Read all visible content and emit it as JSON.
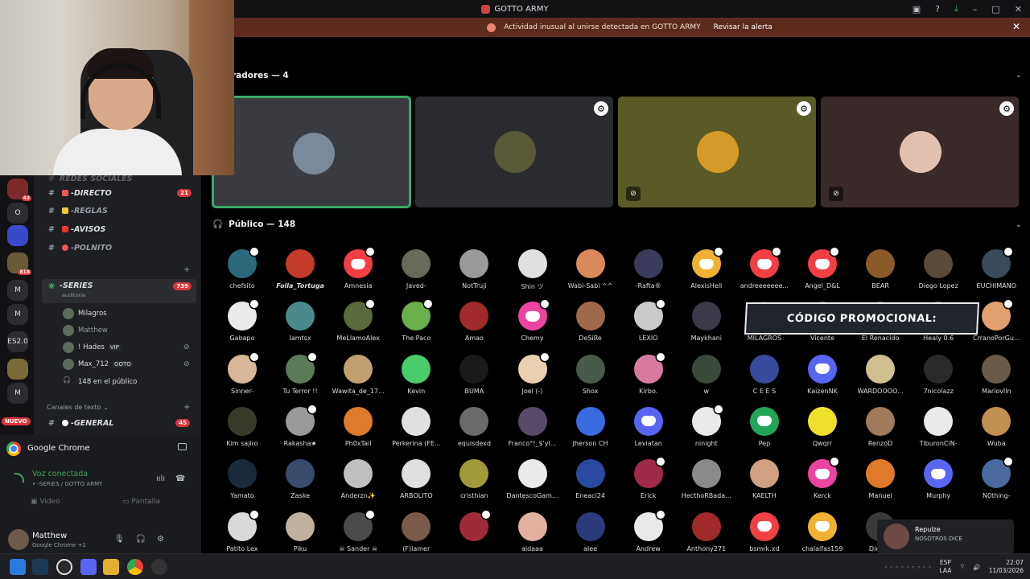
{
  "window": {
    "title": "GOTTO ARMY"
  },
  "alert": {
    "text": "Actividad inusual al unirse detectada en GOTTO ARMY",
    "action": "Revisar la alerta"
  },
  "servers": [
    {
      "label": "",
      "badge": "43",
      "color": "#7a2a2a"
    },
    {
      "label": "O",
      "badge": "",
      "color": "#2b2d31"
    },
    {
      "label": "",
      "badge": "",
      "color": "#3a49c9"
    },
    {
      "label": "",
      "badge": "818",
      "color": "#6a5a3a"
    },
    {
      "label": "M",
      "badge": "",
      "color": "#2b2d31"
    },
    {
      "label": "M",
      "badge": "",
      "color": "#2b2d31"
    },
    {
      "label": "ES2.0",
      "badge": "",
      "color": "#2b2d31"
    },
    {
      "label": "",
      "badge": "",
      "color": "#7a6a3a"
    },
    {
      "label": "M",
      "badge": "",
      "color": "#2b2d31"
    }
  ],
  "nuevo_badge": "NUEVO",
  "channels": {
    "top_faded": "REDES SOCIALES",
    "directo": {
      "name": "DIRECTO",
      "badge": "21"
    },
    "reglas": {
      "name": "REGLAS"
    },
    "avisos": {
      "name": "AVISOS"
    },
    "polnito": {
      "name": "POLNITO"
    },
    "series": {
      "name": "SERIES",
      "badge": "739",
      "sub": "auditoria"
    },
    "text_category": "Canales de texto",
    "general": {
      "name": "GENERAL",
      "badge": "45"
    }
  },
  "voice_users": [
    {
      "name": "Milagros",
      "tag": "",
      "muted": false
    },
    {
      "name": "Matthew",
      "tag": "",
      "muted": false
    },
    {
      "name": "! Hades",
      "tag": "VIP",
      "muted": true
    },
    {
      "name": "Max_712",
      "tag": "GOTO",
      "muted": true
    },
    {
      "name": "148 en el público",
      "tag": "",
      "muted": false
    }
  ],
  "activity": {
    "app": "Google Chrome"
  },
  "voice": {
    "status": "Voz conectada",
    "channel": "• -SERIES / GOTTO ARMY",
    "video": "Video",
    "screen": "Pantalla"
  },
  "user": {
    "name": "Matthew",
    "sub": "Google Chrome +1"
  },
  "stage": {
    "speakers_header": "radores — 4",
    "audience_header": "Público — 148"
  },
  "speaker_tiles": [
    {
      "bg": "#3a3b40",
      "av": "#7a8a9a",
      "gear": false,
      "muted": false,
      "highlight": true
    },
    {
      "bg": "#2a2b2e",
      "av": "#5a5a3a",
      "gear": true,
      "muted": false,
      "highlight": false
    },
    {
      "bg": "#5a5a26",
      "av": "#d59a2a",
      "gear": true,
      "muted": true,
      "highlight": false
    },
    {
      "bg": "#3a2a2a",
      "av": "#e0c0b0",
      "gear": true,
      "muted": true,
      "highlight": false
    }
  ],
  "audience": [
    {
      "name": "chefsito",
      "color": "#2a6a7a",
      "discord": false,
      "hp": true
    },
    {
      "name": "Folla_Tortuga",
      "color": "#c43b2a",
      "discord": false,
      "hp": false
    },
    {
      "name": "Amnesia",
      "color": "#f23f43",
      "discord": true,
      "hp": true
    },
    {
      "name": "Javed-",
      "color": "#6a6a5a",
      "discord": false,
      "hp": false
    },
    {
      "name": "NotTruji",
      "color": "#9a9a9a",
      "discord": false,
      "hp": false
    },
    {
      "name": "Shin ツ",
      "color": "#e0e0e0",
      "discord": false,
      "hp": false
    },
    {
      "name": "Wabi-Sabi ^^",
      "color": "#d98a5a",
      "discord": false,
      "hp": false
    },
    {
      "name": "-Rafta®",
      "color": "#3a3a5a",
      "discord": false,
      "hp": false
    },
    {
      "name": "AlexisHell",
      "color": "#f0b232",
      "discord": true,
      "hp": true
    },
    {
      "name": "andreeeeeee...",
      "color": "#f23f43",
      "discord": true,
      "hp": true
    },
    {
      "name": "Angel_D&L",
      "color": "#f23f43",
      "discord": true,
      "hp": true
    },
    {
      "name": "BEAR",
      "color": "#8a5a2a",
      "discord": false,
      "hp": false
    },
    {
      "name": "Diego Lopez",
      "color": "#5a4a3a",
      "discord": false,
      "hp": false
    },
    {
      "name": "EUCHIMANO",
      "color": "#3a4a5a",
      "discord": false,
      "hp": true
    },
    {
      "name": "Gabapo",
      "color": "#eaeaea",
      "discord": false,
      "hp": true
    },
    {
      "name": "lamtsx",
      "color": "#4a8a8a",
      "discord": false,
      "hp": false
    },
    {
      "name": "MeLlamoAlex",
      "color": "#5a6a3a",
      "discord": false,
      "hp": true
    },
    {
      "name": "The Paco",
      "color": "#6ab04a",
      "discord": false,
      "hp": true
    },
    {
      "name": "Amao",
      "color": "#a02a2a",
      "discord": false,
      "hp": false
    },
    {
      "name": "Chemy",
      "color": "#eb459f",
      "discord": true,
      "hp": true
    },
    {
      "name": "DeSiRe",
      "color": "#a06a4a",
      "discord": false,
      "hp": false
    },
    {
      "name": "LEXIO",
      "color": "#cacaca",
      "discord": false,
      "hp": true
    },
    {
      "name": "Maykhani",
      "color": "#3a3a4a",
      "discord": false,
      "hp": false
    },
    {
      "name": "MILAGROS",
      "color": "#4a4a4a",
      "discord": false,
      "hp": false
    },
    {
      "name": "Vicente",
      "color": "#5a5a5a",
      "discord": false,
      "hp": false
    },
    {
      "name": "El Renacido",
      "color": "#5a5a5a",
      "discord": false,
      "hp": false
    },
    {
      "name": "Healy 0.6",
      "color": "#5a5a5a",
      "discord": false,
      "hp": false
    },
    {
      "name": "CrranoPorGu...",
      "color": "#e0a070",
      "discord": false,
      "hp": true
    },
    {
      "name": "Sinner-",
      "color": "#d8b898",
      "discord": false,
      "hp": true
    },
    {
      "name": "Tu Terror !!",
      "color": "#5a7a5a",
      "discord": false,
      "hp": true
    },
    {
      "name": "Wawita_de_17...",
      "color": "#c0a070",
      "discord": false,
      "hp": false
    },
    {
      "name": "Kevin",
      "color": "#4acc6a",
      "discord": false,
      "hp": false
    },
    {
      "name": "BUMA",
      "color": "#1a1a1a",
      "discord": false,
      "hp": false
    },
    {
      "name": "Joel (-)",
      "color": "#e8d0b0",
      "discord": false,
      "hp": true
    },
    {
      "name": "Shox",
      "color": "#4a5a4a",
      "discord": false,
      "hp": false
    },
    {
      "name": "Kirbo.",
      "color": "#d87aa0",
      "discord": false,
      "hp": true
    },
    {
      "name": "w",
      "color": "#3a4a3a",
      "discord": false,
      "hp": false
    },
    {
      "name": "C E E S",
      "color": "#3a4a9a",
      "discord": false,
      "hp": false
    },
    {
      "name": "KaizenNK",
      "color": "#5865f2",
      "discord": true,
      "hp": false
    },
    {
      "name": "WARDOOOO...",
      "color": "#d0c090",
      "discord": false,
      "hp": false
    },
    {
      "name": "7nicolazz",
      "color": "#2a2a2a",
      "discord": false,
      "hp": false
    },
    {
      "name": "Mariovlln",
      "color": "#6a5a4a",
      "discord": false,
      "hp": false
    },
    {
      "name": "Kim sajiro",
      "color": "#3a3a2a",
      "discord": false,
      "hp": false
    },
    {
      "name": "Rakasha★",
      "color": "#9a9a9a",
      "discord": false,
      "hp": true
    },
    {
      "name": "Ph0xTail",
      "color": "#e07a2a",
      "discord": false,
      "hp": false
    },
    {
      "name": "Perkerina (FE...",
      "color": "#e0e0e0",
      "discord": false,
      "hp": false
    },
    {
      "name": "equisdexd",
      "color": "#6a6a6a",
      "discord": false,
      "hp": false
    },
    {
      "name": "Franco°!_$'yl...",
      "color": "#5a4a6a",
      "discord": false,
      "hp": false
    },
    {
      "name": "Jherson CH",
      "color": "#3a6ae0",
      "discord": false,
      "hp": false
    },
    {
      "name": "Leviatan",
      "color": "#5865f2",
      "discord": true,
      "hp": false
    },
    {
      "name": "ninight",
      "color": "#eaeaea",
      "discord": false,
      "hp": true
    },
    {
      "name": "Pep",
      "color": "#23a559",
      "discord": true,
      "hp": false
    },
    {
      "name": "Qwqrr",
      "color": "#f0e02a",
      "discord": false,
      "hp": false
    },
    {
      "name": "RenzoD",
      "color": "#a07a5a",
      "discord": false,
      "hp": false
    },
    {
      "name": "TiburonCiN-",
      "color": "#eaeaea",
      "discord": false,
      "hp": false
    },
    {
      "name": "Wuba",
      "color": "#c09050",
      "discord": false,
      "hp": false
    },
    {
      "name": "Yamato",
      "color": "#1a2a3a",
      "discord": false,
      "hp": false
    },
    {
      "name": "Zaske",
      "color": "#3a4a6a",
      "discord": false,
      "hp": false
    },
    {
      "name": "Anderzn✨",
      "color": "#c0c0c0",
      "discord": false,
      "hp": false
    },
    {
      "name": "ARBOLITO",
      "color": "#e0e0e0",
      "discord": false,
      "hp": false
    },
    {
      "name": "cristhian",
      "color": "#a09a3a",
      "discord": false,
      "hp": false
    },
    {
      "name": "DantescoGam...",
      "color": "#eaeaea",
      "discord": false,
      "hp": false
    },
    {
      "name": "Eneaci24",
      "color": "#2a4aa0",
      "discord": false,
      "hp": false
    },
    {
      "name": "Erick",
      "color": "#a02a4a",
      "discord": false,
      "hp": true
    },
    {
      "name": "HecthoRBada...",
      "color": "#8a8a8a",
      "discord": false,
      "hp": false
    },
    {
      "name": "KAELTH",
      "color": "#d0a080",
      "discord": false,
      "hp": false
    },
    {
      "name": "Kerck",
      "color": "#eb459f",
      "discord": true,
      "hp": true
    },
    {
      "name": "Manuel",
      "color": "#e07a2a",
      "discord": false,
      "hp": false
    },
    {
      "name": "Murphy",
      "color": "#5865f2",
      "discord": true,
      "hp": false
    },
    {
      "name": "N0thing-",
      "color": "#4a6aa0",
      "discord": false,
      "hp": true
    },
    {
      "name": "Patito Lex",
      "color": "#dadada",
      "discord": false,
      "hp": true
    },
    {
      "name": "Piku",
      "color": "#c0b0a0",
      "discord": false,
      "hp": false
    },
    {
      "name": "☠ Sander ☠",
      "color": "#4a4a4a",
      "discord": false,
      "hp": true
    },
    {
      "name": "(F)lamer",
      "color": "#7a5a4a",
      "discord": false,
      "hp": false
    },
    {
      "name": "",
      "color": "#a02a3a",
      "discord": false,
      "hp": true
    },
    {
      "name": "aldaaa",
      "color": "#e0b0a0",
      "discord": false,
      "hp": false
    },
    {
      "name": "alee",
      "color": "#2a3a7a",
      "discord": false,
      "hp": false
    },
    {
      "name": "Andrew",
      "color": "#eaeaea",
      "discord": false,
      "hp": true
    },
    {
      "name": "Anthony271",
      "color": "#a02a2a",
      "discord": false,
      "hp": false
    },
    {
      "name": "bsmrk.xd",
      "color": "#f23f43",
      "discord": true,
      "hp": false
    },
    {
      "name": "chalaifas159",
      "color": "#f0b232",
      "discord": true,
      "hp": false
    },
    {
      "name": "Diegob",
      "color": "#3a3a3a",
      "discord": false,
      "hp": false
    }
  ],
  "promo": {
    "text": "CÓDIGO PROMOCIONAL:"
  },
  "notification": {
    "title": "Repulze",
    "sub": "NOSOTROS DICE"
  },
  "taskbar": {
    "lang_top": "ESP",
    "lang_bottom": "LAA",
    "time": "22:07",
    "date": "11/03/2026"
  }
}
